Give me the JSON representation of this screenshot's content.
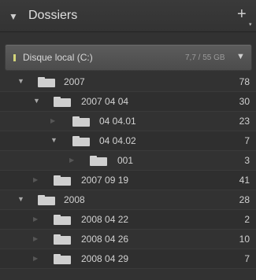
{
  "header": {
    "title": "Dossiers",
    "caret": "▼",
    "add": "+",
    "add_sub": "▾"
  },
  "disk": {
    "label": "Disque local (C:)",
    "size": "7,7 / 55 GB",
    "arrow": "▼"
  },
  "tree": {
    "rows": [
      {
        "name": "2007",
        "count": "78",
        "expanded": true
      },
      {
        "name": "2007 04 04",
        "count": "30",
        "expanded": true
      },
      {
        "name": "04 04.01",
        "count": "23",
        "expanded": false
      },
      {
        "name": "04 04.02",
        "count": "7",
        "expanded": true
      },
      {
        "name": "001",
        "count": "3",
        "expanded": false
      },
      {
        "name": "2007 09 19",
        "count": "41",
        "expanded": false
      },
      {
        "name": "2008",
        "count": "28",
        "expanded": true
      },
      {
        "name": "2008 04 22",
        "count": "2",
        "expanded": false
      },
      {
        "name": "2008 04 26",
        "count": "10",
        "expanded": false
      },
      {
        "name": "2008 04 29",
        "count": "7",
        "expanded": false
      }
    ],
    "expanded_glyph": "▼",
    "collapsed_glyph": "▶"
  }
}
